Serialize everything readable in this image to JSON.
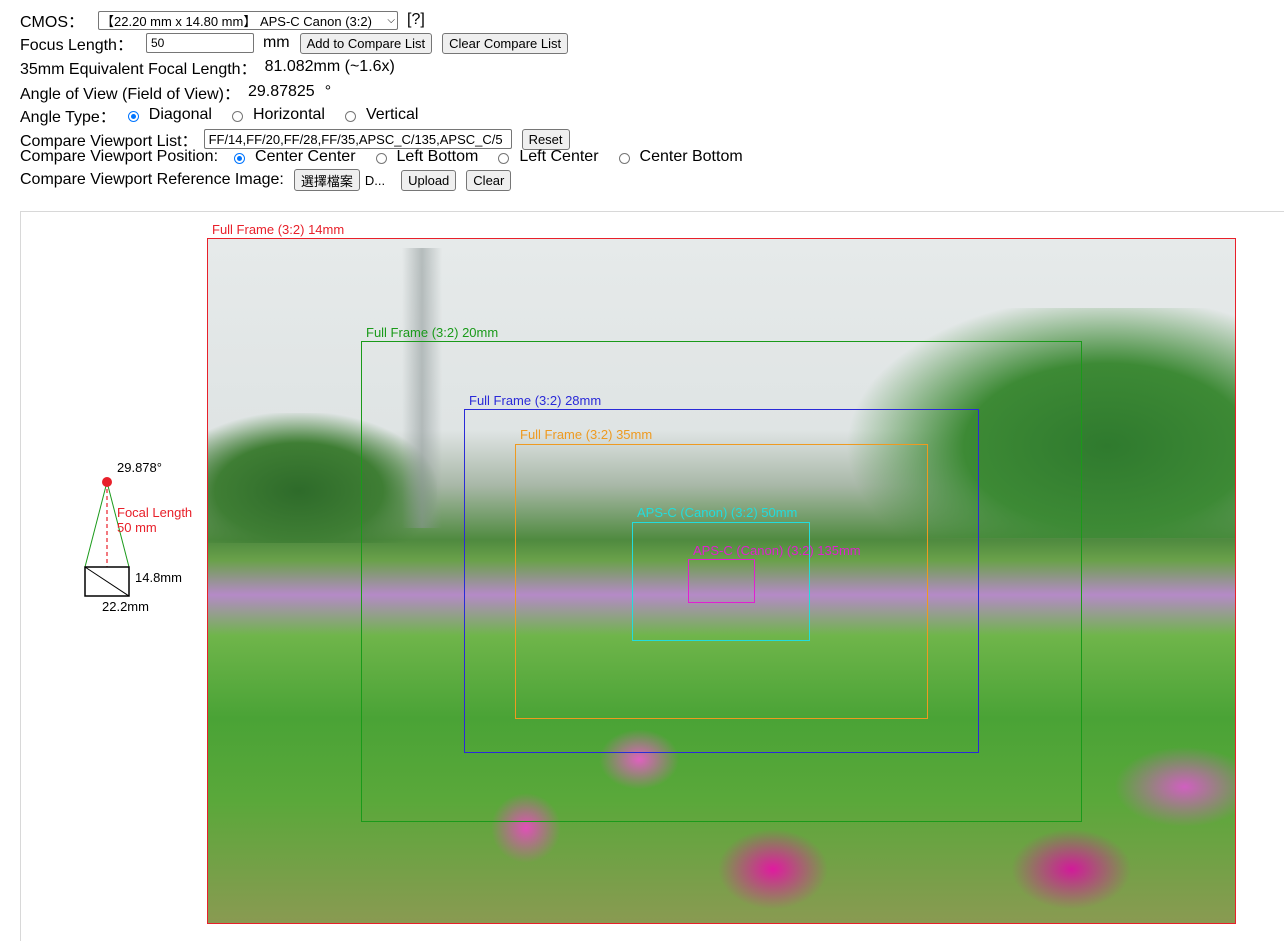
{
  "controls": {
    "cmos_label": "CMOS：",
    "cmos_value": "【22.20 mm x 14.80 mm】 APS-C Canon (3:2)",
    "help_link": "[?]",
    "focus_label": "Focus Length：",
    "focus_value": "50",
    "focus_unit": "mm",
    "add_compare": "Add to Compare List",
    "clear_compare": "Clear Compare List",
    "equiv_label": "35mm Equivalent Focal Length：",
    "equiv_value": "81.082mm (~1.6x)",
    "aov_label": "Angle of View (Field of View)：",
    "aov_value": "29.87825",
    "aov_unit": "°",
    "angle_type_label": "Angle Type：",
    "angle_types": [
      "Diagonal",
      "Horizontal",
      "Vertical"
    ],
    "angle_type_selected": "Diagonal",
    "viewport_list_label": "Compare Viewport List：",
    "viewport_list_value": "FF/14,FF/20,FF/28,FF/35,APSC_C/135,APSC_C/5",
    "reset": "Reset",
    "position_label": "Compare Viewport Position:",
    "positions": [
      "Center Center",
      "Left Bottom",
      "Left Center",
      "Center Bottom"
    ],
    "position_selected": "Center Center",
    "ref_image_label": "Compare Viewport Reference Image:",
    "choose_file": "選擇檔案",
    "file_name": "D...",
    "upload": "Upload",
    "clear": "Clear"
  },
  "diagram": {
    "angle": "29.878°",
    "focal_label": "Focal Length",
    "focal_value": "50 mm",
    "height": "14.8mm",
    "width": "22.2mm"
  },
  "viewports": [
    {
      "label": "Full Frame (3:2) 14mm",
      "color": "#e8202a"
    },
    {
      "label": "Full Frame (3:2) 20mm",
      "color": "#1a9a1a"
    },
    {
      "label": "Full Frame (3:2) 28mm",
      "color": "#2a2ad8"
    },
    {
      "label": "Full Frame (3:2) 35mm",
      "color": "#ee9a20"
    },
    {
      "label": "APS-C (Canon) (3:2) 50mm",
      "color": "#22dddd"
    },
    {
      "label": "APS-C (Canon) (3:2) 135mm",
      "color": "#e020d0"
    }
  ]
}
